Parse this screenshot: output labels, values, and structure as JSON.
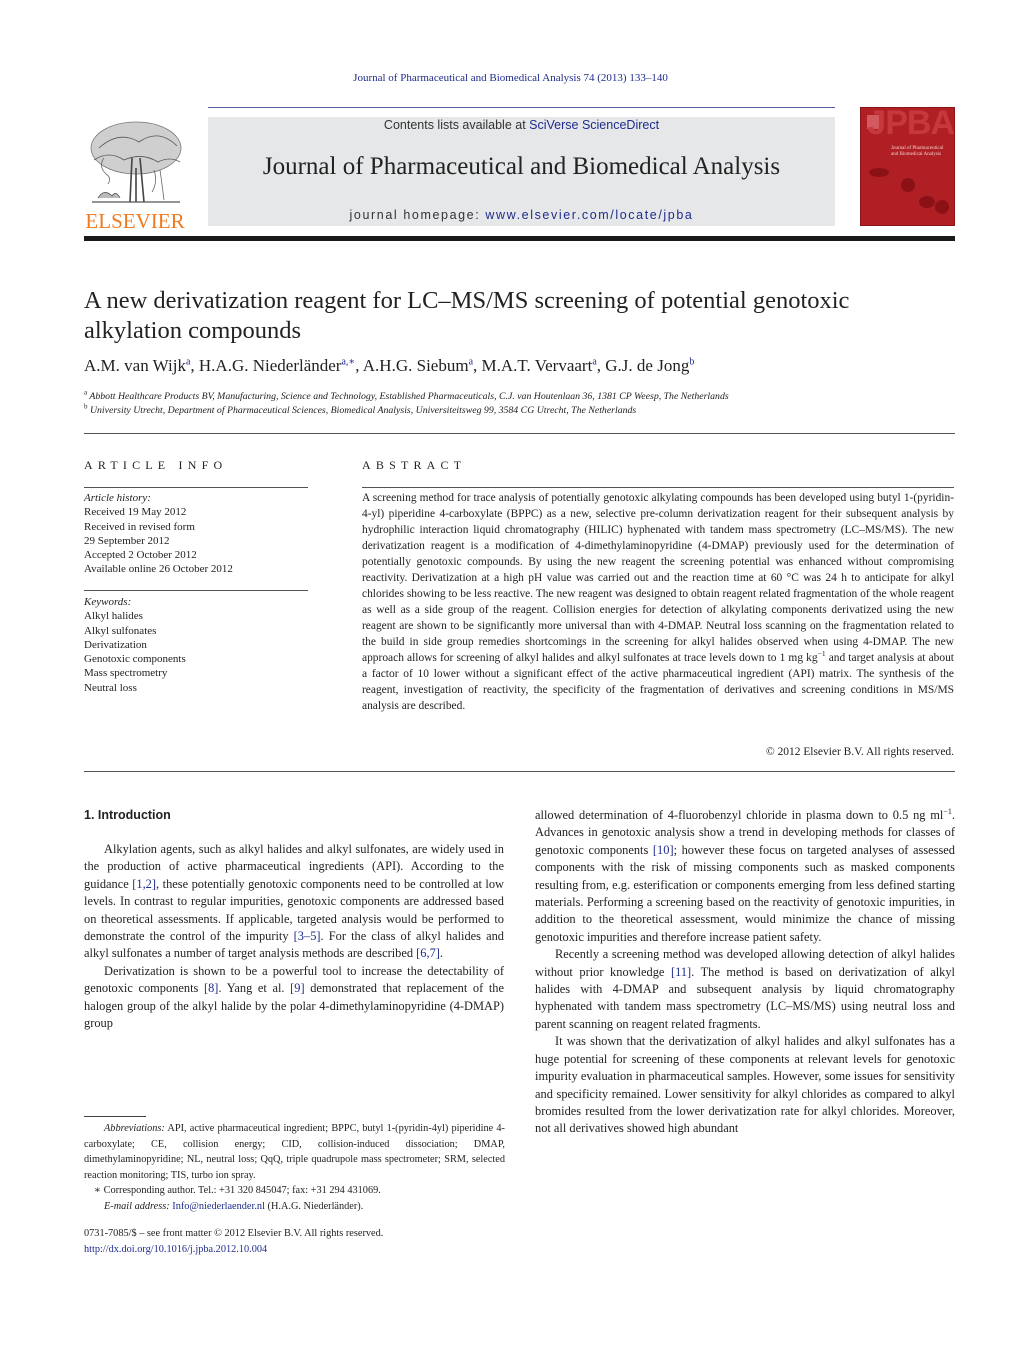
{
  "running_head": "Journal of Pharmaceutical and Biomedical Analysis 74 (2013) 133–140",
  "banner": {
    "contents_prefix": "Contents lists available at ",
    "contents_link": "SciVerse ScienceDirect",
    "journal_name": "Journal of Pharmaceutical and Biomedical Analysis",
    "homepage_prefix": "journal homepage: ",
    "homepage_link": "www.elsevier.com/locate/jpba"
  },
  "publisher_logo": {
    "text": "ELSEVIER",
    "color": "#f07a20"
  },
  "cover": {
    "acronym": "JPBA",
    "title_line1": "Journal of Pharmaceutical",
    "title_line2": "and Biomedical Analysis",
    "color": "#b01f24"
  },
  "article": {
    "title": "A new derivatization reagent for LC–MS/MS screening of potential genotoxic alkylation compounds",
    "authors": [
      {
        "name": "A.M. van Wijk",
        "sup": "a",
        "sep": ", "
      },
      {
        "name": "H.A.G. Niederländer",
        "sup": "a,∗",
        "sep": ", "
      },
      {
        "name": "A.H.G. Siebum",
        "sup": "a",
        "sep": ", "
      },
      {
        "name": "M.A.T. Vervaart",
        "sup": "a",
        "sep": ", "
      },
      {
        "name": "G.J. de Jong",
        "sup": "b",
        "sep": ""
      }
    ],
    "affiliations": [
      {
        "mark": "a",
        "text": "Abbott Healthcare Products BV, Manufacturing, Science and Technology, Established Pharmaceuticals, C.J. van Houtenlaan 36, 1381 CP Weesp, The Netherlands"
      },
      {
        "mark": "b",
        "text": "University Utrecht, Department of Pharmaceutical Sciences, Biomedical Analysis, Universiteitsweg 99, 3584 CG Utrecht, The Netherlands"
      }
    ]
  },
  "article_info": {
    "heading": "ARTICLE INFO",
    "history_label": "Article history:",
    "history": [
      "Received 19 May 2012",
      "Received in revised form",
      "29 September 2012",
      "Accepted 2 October 2012",
      "Available online 26 October 2012"
    ],
    "keywords_label": "Keywords:",
    "keywords": [
      "Alkyl halides",
      "Alkyl sulfonates",
      "Derivatization",
      "Genotoxic components",
      "Mass spectrometry",
      "Neutral loss"
    ]
  },
  "abstract": {
    "heading": "ABSTRACT",
    "text_part1": "A screening method for trace analysis of potentially genotoxic alkylating compounds has been developed using butyl 1-(pyridin-4-yl) piperidine 4-carboxylate (BPPC) as a new, selective pre-column derivatization reagent for their subsequent analysis by hydrophilic interaction liquid chromatography (HILIC) hyphenated with tandem mass spectrometry (LC–MS/MS). The new derivatization reagent is a modification of 4-dimethylaminopyridine (4-DMAP) previously used for the determination of potentially genotoxic compounds. By using the new reagent the screening potential was enhanced without compromising reactivity. Derivatization at a high pH value was carried out and the reaction time at 60 °C was 24 h to anticipate for alkyl chlorides showing to be less reactive. The new reagent was designed to obtain reagent related fragmentation of the whole reagent as well as a side group of the reagent. Collision energies for detection of alkylating components derivatized using the new reagent are shown to be significantly more universal than with 4-DMAP. Neutral loss scanning on the fragmentation related to the build in side group remedies shortcomings in the screening for alkyl halides observed when using 4-DMAP. The new approach allows for screening of alkyl halides and alkyl sulfonates at trace levels down to 1 mg kg",
    "text_sup": "−1",
    "text_part2": " and target analysis at about a factor of 10 lower without a significant effect of the active pharmaceutical ingredient (API) matrix. The synthesis of the reagent, investigation of reactivity, the specificity of the fragmentation of derivatives and screening conditions in MS/MS analysis are described.",
    "copyright": "© 2012 Elsevier B.V. All rights reserved."
  },
  "introduction": {
    "heading": "1.  Introduction",
    "left_col": {
      "p1_a": "Alkylation agents, such as alkyl halides and alkyl sulfonates, are widely used in the production of active pharmaceutical ingredients (API). According to the guidance ",
      "p1_ref1": "[1,2]",
      "p1_b": ", these potentially genotoxic components need to be controlled at low levels. In contrast to regular impurities, genotoxic components are addressed based on theoretical assessments. If applicable, targeted analysis would be performed to demonstrate the control of the impurity ",
      "p1_ref2": "[3–5]",
      "p1_c": ". For the class of alkyl halides and alkyl sulfonates a number of target analysis methods are described ",
      "p1_ref3": "[6,7]",
      "p1_d": ".",
      "p2_a": "Derivatization is shown to be a powerful tool to increase the detectability of genotoxic components ",
      "p2_ref1": "[8]",
      "p2_b": ". Yang et al. ",
      "p2_ref2": "[9]",
      "p2_c": " demonstrated that replacement of the halogen group of the alkyl halide by the polar 4-dimethylaminopyridine (4-DMAP) group"
    },
    "right_col": {
      "p1_a": "allowed determination of 4-fluorobenzyl chloride in plasma down to 0.5 ng ml",
      "p1_sup": "−1",
      "p1_b": ". Advances in genotoxic analysis show a trend in developing methods for classes of genotoxic components ",
      "p1_ref1": "[10]",
      "p1_c": "; however these focus on targeted analyses of assessed components with the risk of missing components such as masked components resulting from, e.g. esterification or components emerging from less defined starting materials. Performing a screening based on the reactivity of genotoxic impurities, in addition to the theoretical assessment, would minimize the chance of missing genotoxic impurities and therefore increase patient safety.",
      "p2_a": "Recently a screening method was developed allowing detection of alkyl halides without prior knowledge ",
      "p2_ref1": "[11]",
      "p2_b": ". The method is based on derivatization of alkyl halides with 4-DMAP and subsequent analysis by liquid chromatography hyphenated with tandem mass spectrometry (LC–MS/MS) using neutral loss and parent scanning on reagent related fragments.",
      "p3": "It was shown that the derivatization of alkyl halides and alkyl sulfonates has a huge potential for screening of these components at relevant levels for genotoxic impurity evaluation in pharmaceutical samples. However, some issues for sensitivity and specificity remained. Lower sensitivity for alkyl chlorides as compared to alkyl bromides resulted from the lower derivatization rate for alkyl chlorides. Moreover, not all derivatives showed high abundant"
    }
  },
  "footnotes": {
    "abbrev_label": "Abbreviations:",
    "abbrev_text": "  API, active pharmaceutical ingredient; BPPC, butyl 1-(pyridin-4yl) piperidine 4-carboxylate; CE, collision energy; CID, collision-induced dissociation; DMAP, dimethylaminopyridine; NL, neutral loss; QqQ, triple quadrupole mass spectrometer; SRM, selected reaction monitoring; TIS, turbo ion spray.",
    "corresponding": "∗ Corresponding author. Tel.: +31 320 845047; fax: +31 294 431069.",
    "email_label": "E-mail address: ",
    "email": "Info@niederlaender.nl",
    "email_suffix": " (H.A.G. Niederländer).",
    "issn": "0731-7085/$ – see front matter © 2012 Elsevier B.V. All rights reserved.",
    "doi": "http://dx.doi.org/10.1016/j.jpba.2012.10.004"
  }
}
